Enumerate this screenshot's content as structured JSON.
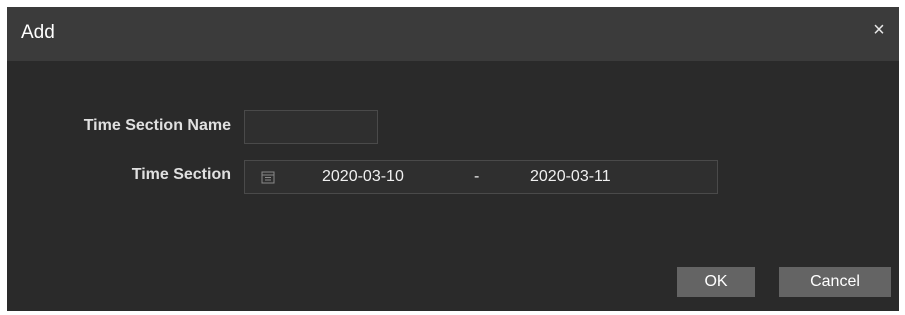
{
  "dialog": {
    "title": "Add",
    "close_glyph": "×",
    "close_icon": "close-icon"
  },
  "form": {
    "name_label": "Time Section Name",
    "name_value": "",
    "section_label": "Time Section",
    "calendar_icon": "calendar-icon",
    "start_date": "2020-03-10",
    "separator": "-",
    "end_date": "2020-03-11"
  },
  "buttons": {
    "ok_label": "OK",
    "cancel_label": "Cancel"
  },
  "colors": {
    "dialog_bg": "#2a2a2a",
    "titlebar_bg": "#3b3b3b",
    "button_bg": "#646464"
  }
}
